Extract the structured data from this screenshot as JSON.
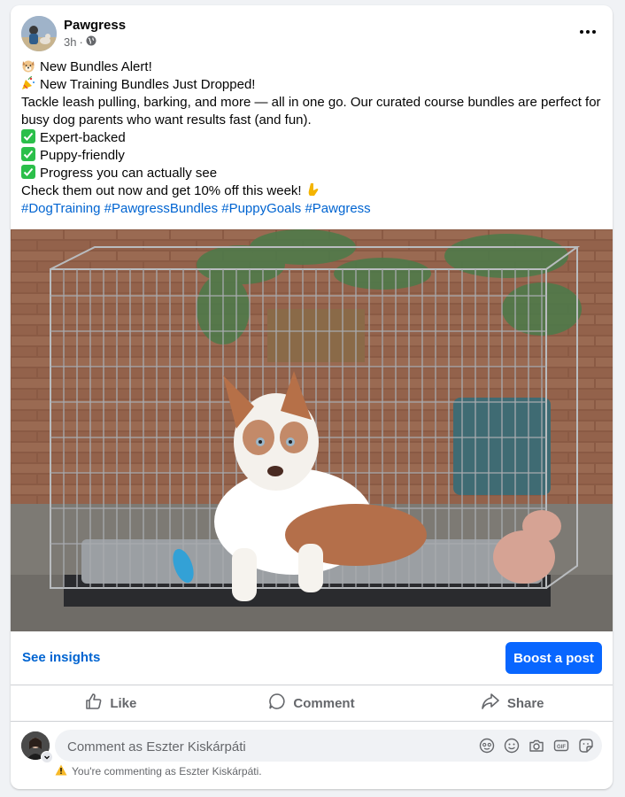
{
  "post": {
    "page_name": "Pawgress",
    "time": "3h",
    "separator": "·",
    "privacy_icon": "globe-icon",
    "more_icon": "more-horizontal-icon",
    "lines": [
      {
        "icon": "dog-face-emoji",
        "text": "New Bundles Alert!"
      },
      {
        "icon": "party-popper-emoji",
        "text": "New Training Bundles Just Dropped!"
      },
      {
        "icon": "",
        "text": "Tackle leash pulling, barking, and more — all in one go. Our curated course bundles are perfect for busy dog parents who want results fast (and fun)."
      },
      {
        "icon": "check-mark-emoji",
        "text": "Expert-backed"
      },
      {
        "icon": "check-mark-emoji",
        "text": "Puppy-friendly"
      },
      {
        "icon": "check-mark-emoji",
        "text": "Progress you can actually see"
      },
      {
        "icon": "pointing-down-emoji",
        "text": "Check them out now and get 10% off this week!"
      }
    ],
    "hashtags": "#DogTraining #PawgressBundles #PuppyGoals #Pawgress"
  },
  "insights": {
    "see_insights": "See insights",
    "boost": "Boost a post"
  },
  "actions": {
    "like": "Like",
    "comment": "Comment",
    "share": "Share"
  },
  "comment_box": {
    "placeholder": "Comment as Eszter Kiskárpáti",
    "icons": [
      "avatar-sticker-icon",
      "emoji-icon",
      "camera-icon",
      "gif-icon",
      "sticker-icon"
    ],
    "notice": "You're commenting as Eszter Kiskárpáti."
  },
  "colors": {
    "link": "#0064d1",
    "boost": "#0866ff",
    "check": "#2bbf4a",
    "warning": "#f7b928"
  }
}
